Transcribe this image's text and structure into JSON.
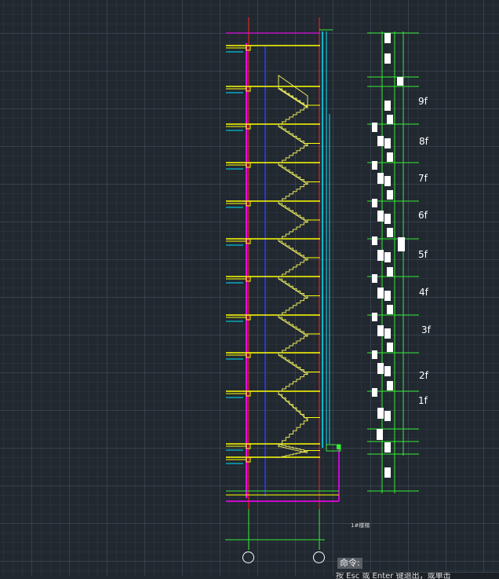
{
  "drawing": {
    "floor_labels": [
      "9f",
      "8f",
      "7f",
      "6f",
      "5f",
      "4f",
      "3f",
      "2f",
      "1f"
    ],
    "sheet_label": "1#楼梯",
    "colors": {
      "background": "#212830",
      "grid": "#505c6e",
      "floor_slab": "#ffff00",
      "stair_flight": "#e8e85a",
      "axis_line": "#ff2020",
      "wall_magenta": "#ff00ff",
      "blue_line": "#2040ff",
      "cyan_line": "#00e5ff",
      "dimension_green": "#33ee33",
      "marker_white": "#ffffff"
    }
  },
  "command_line": {
    "prompt": "命令:",
    "input_text": "按 Esc 或 Enter 键退出，或单击"
  }
}
